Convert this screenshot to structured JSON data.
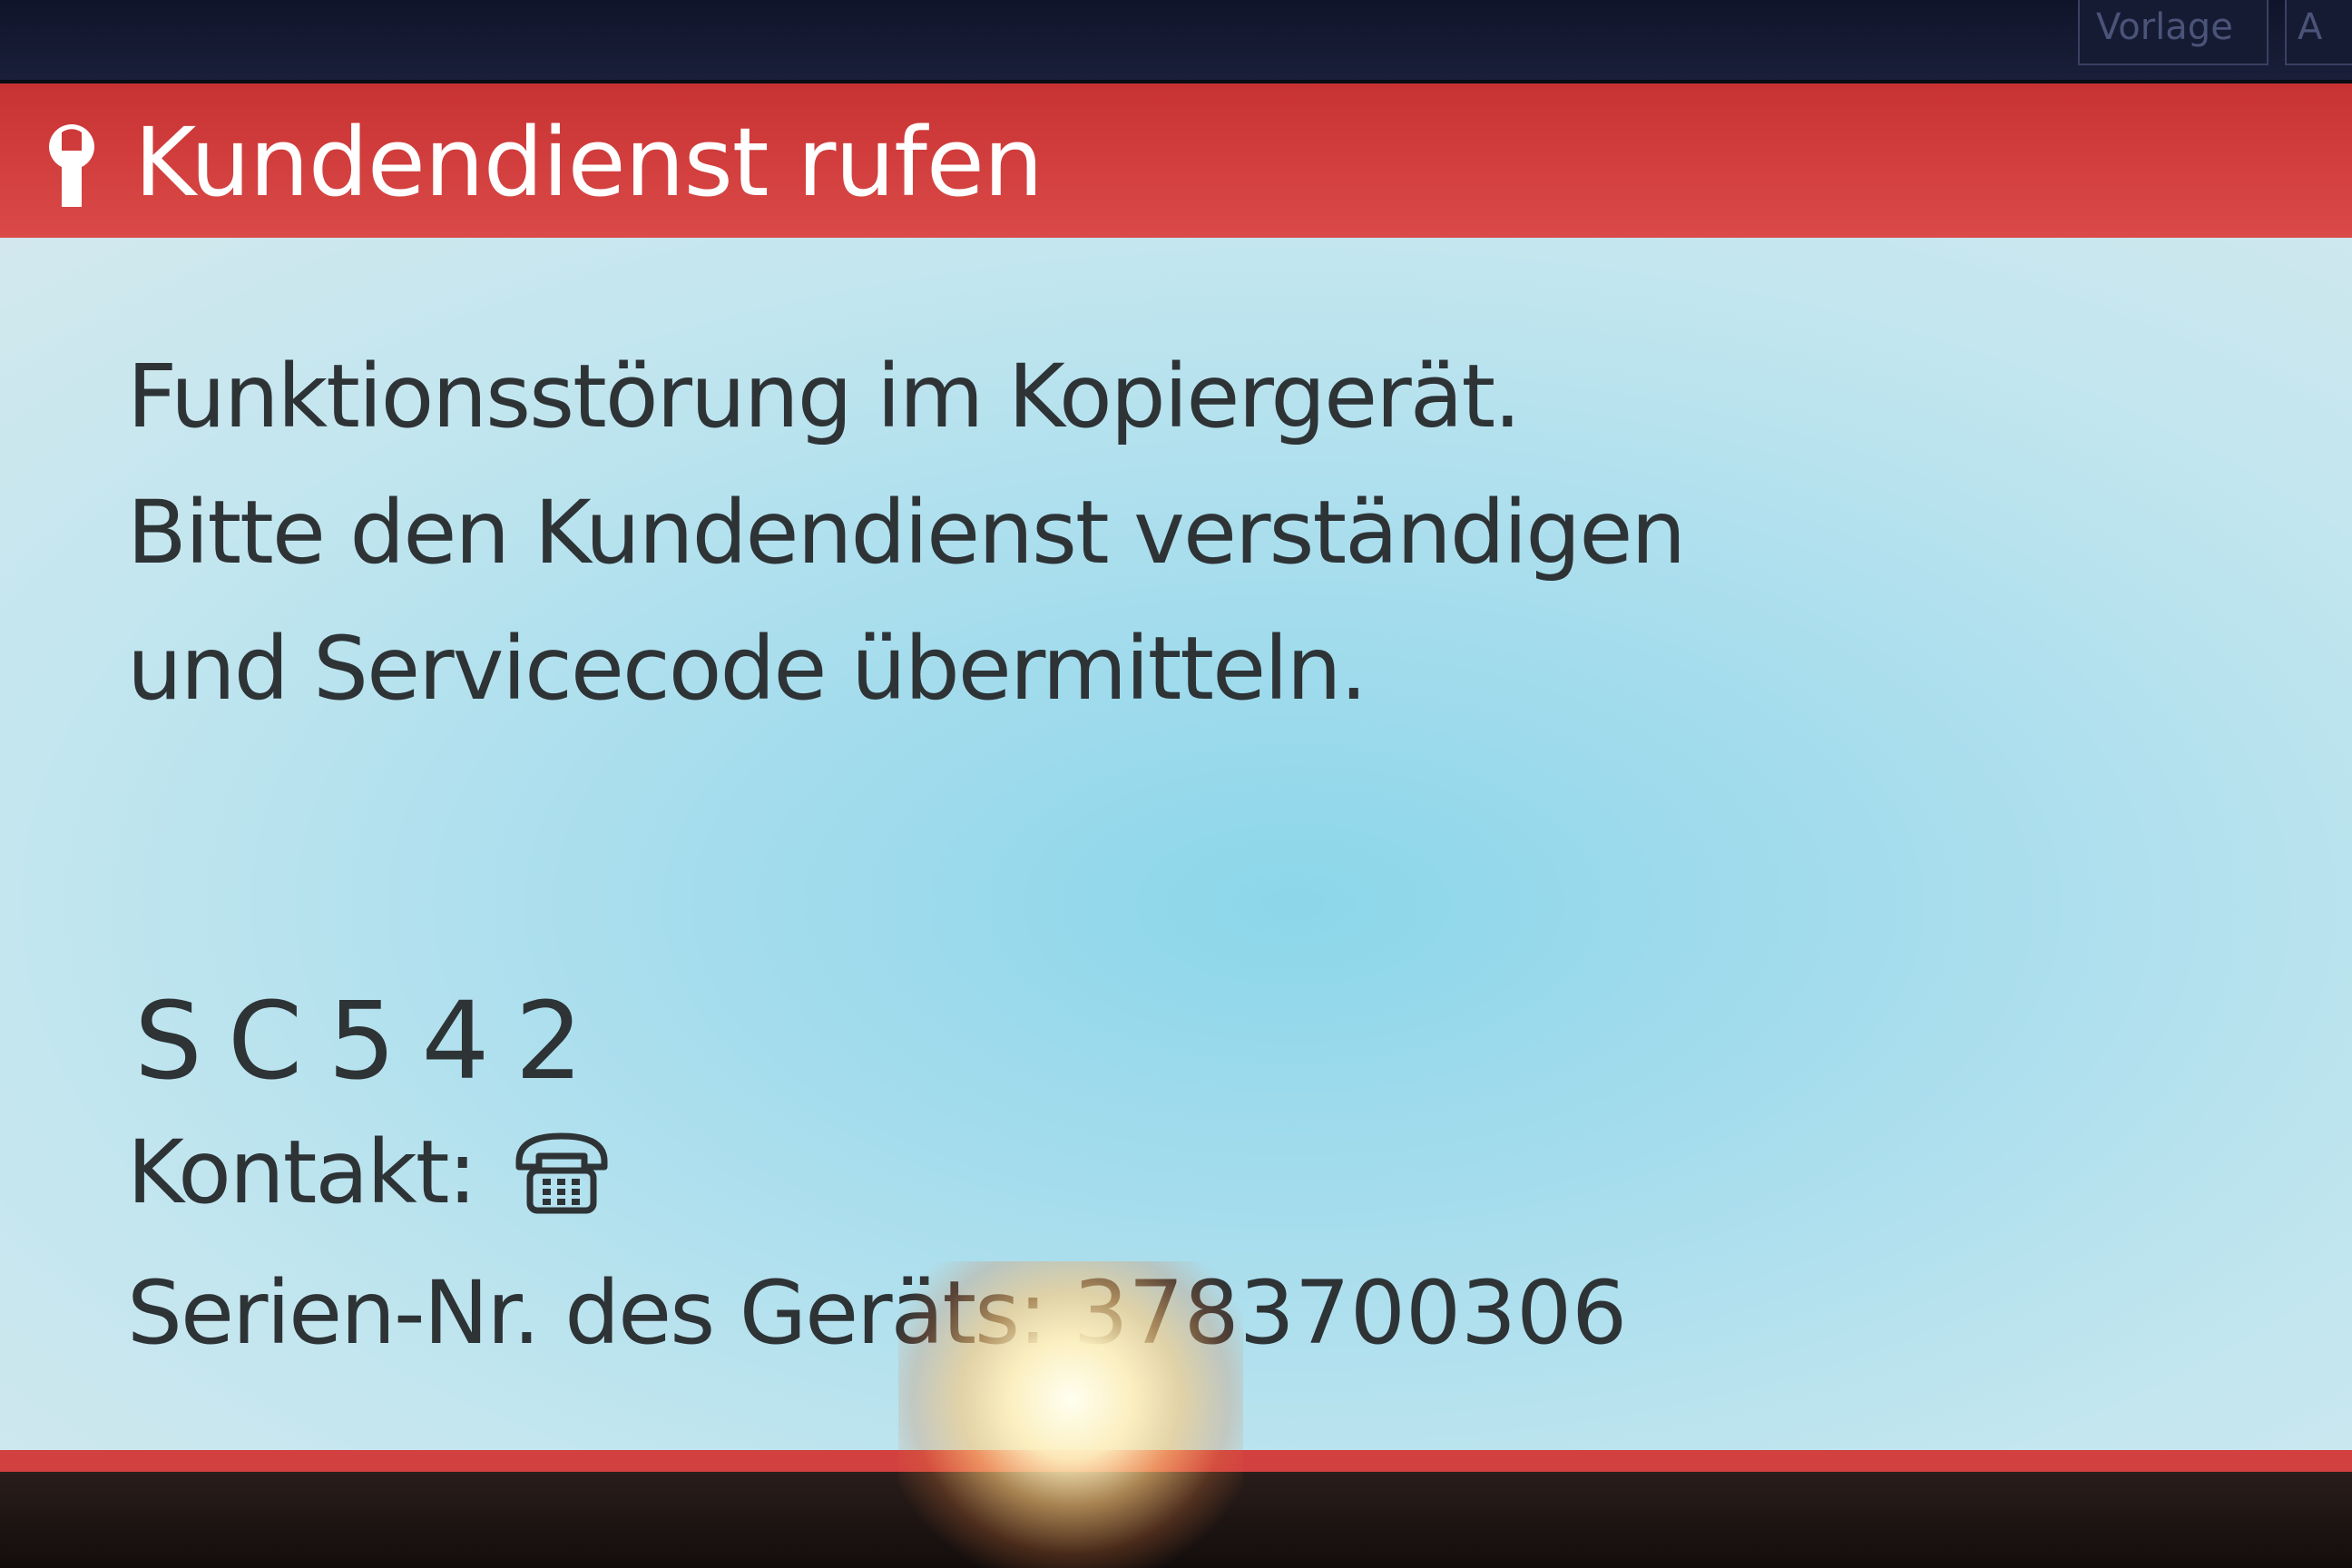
{
  "top_tabs": [
    {
      "label": "Vorlage"
    },
    {
      "label": "A"
    }
  ],
  "dialog": {
    "title": "Kundendienst rufen",
    "title_icon": "wrench-icon",
    "message_lines": [
      "Funktionsstörung im Kopiergerät.",
      "Bitte den Kundendienst verständigen",
      "und Servicecode übermitteln."
    ],
    "service_code": "SC542",
    "contact_label": "Kontakt:",
    "contact_icon": "phone-icon",
    "serial_label": "Serien-Nr. des Geräts:",
    "serial_value": "3783700306"
  },
  "colors": {
    "header_red": "#d24040",
    "body_blue": "#a7dded",
    "text_dark": "#2e3336",
    "title_white": "#ffffff"
  }
}
